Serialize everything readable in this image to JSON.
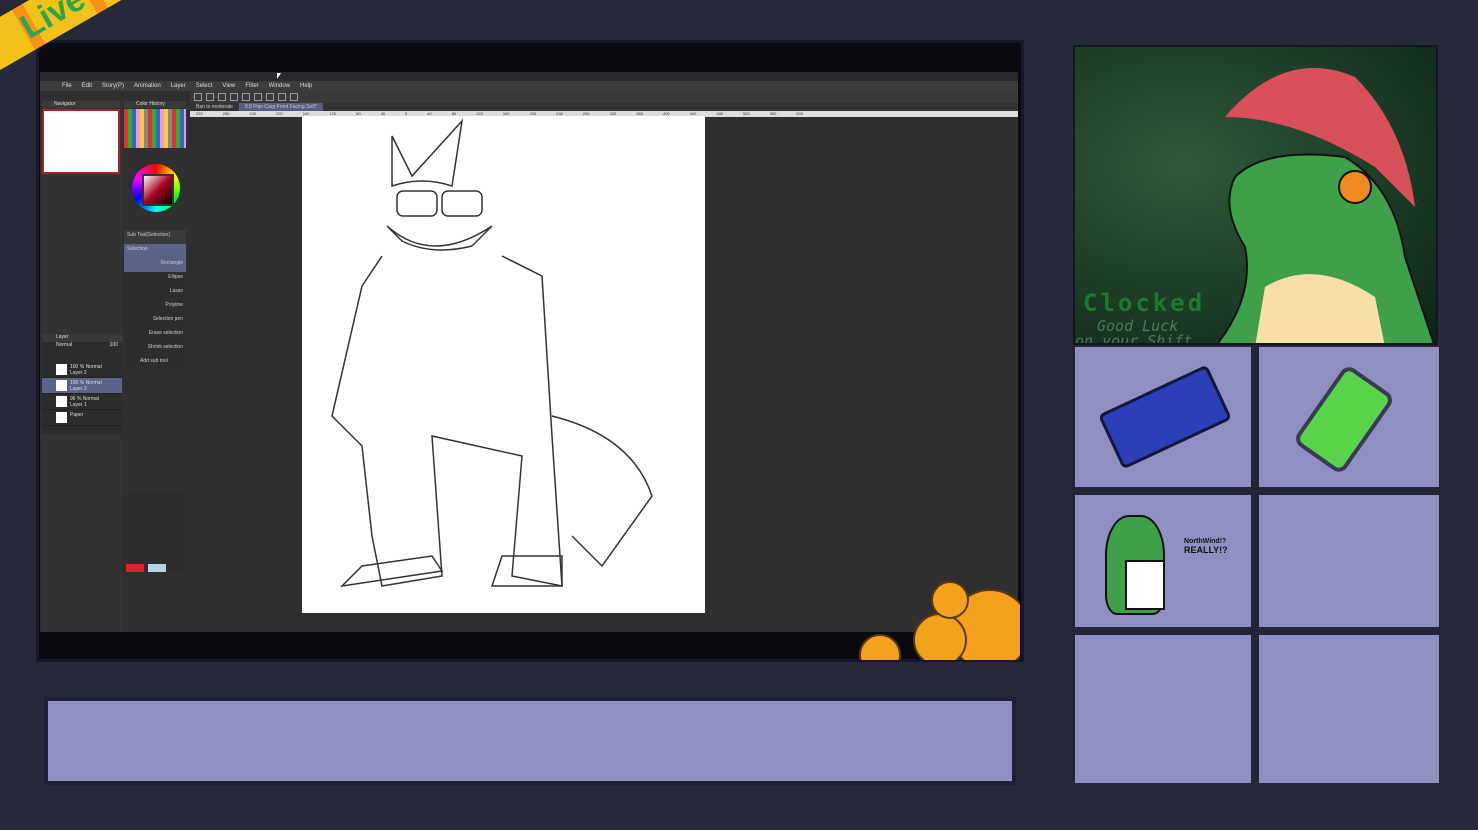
{
  "overlay": {
    "banner_text": "Live Fish",
    "webcam": {
      "title": "Clocked",
      "line1": "Good Luck",
      "line2": "on your Shift"
    },
    "sticker_text": {
      "line1": "NorthWind!?",
      "line2": "REALLY!?"
    },
    "accent_colors": {
      "banner": "#f3c21a",
      "panel": "#8f90c2",
      "background": "#272838"
    }
  },
  "app": {
    "menu": [
      "File",
      "Edit",
      "Story(P)",
      "Animation",
      "Layer",
      "Select",
      "View",
      "Filter",
      "Window",
      "Help"
    ],
    "tabs": [
      "Ban to moderate",
      "8.8 Flan Carp Front Facing Soft*"
    ],
    "panels": {
      "navigator": "Navigator",
      "color_history": "Color History",
      "layer": "Layer"
    },
    "tool_property": {
      "header": "Sub Tool[Selection]",
      "items": [
        "Selection",
        "Rectangle",
        "Ellipse",
        "Lasso",
        "Polyline",
        "Selection pen",
        "Erase selection",
        "Shrink selection"
      ],
      "add_subtool": "Add sub tool",
      "selected": "Rectangle"
    },
    "layers": {
      "blend": "Normal",
      "opacity": "100",
      "items": [
        {
          "mode": "100 % Normal",
          "name": "Layer 2"
        },
        {
          "mode": "100 % Normal",
          "name": "Layer 3",
          "selected": true
        },
        {
          "mode": "96 % Normal",
          "name": "Layer 1"
        },
        {
          "mode": "",
          "name": "Paper"
        }
      ]
    },
    "ruler_ticks": [
      "320",
      "280",
      "240",
      "200",
      "160",
      "120",
      "80",
      "40",
      "0",
      "40",
      "80",
      "120",
      "160",
      "200",
      "240",
      "280",
      "320",
      "360",
      "400",
      "440",
      "480",
      "520",
      "560",
      "600"
    ]
  }
}
